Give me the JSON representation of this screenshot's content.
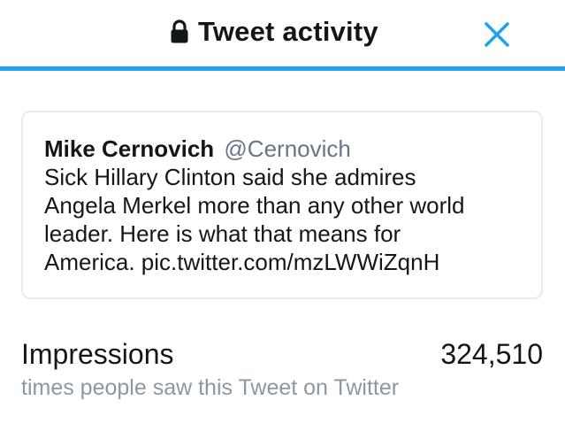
{
  "header": {
    "title": "Tweet activity",
    "icon": "lock-icon",
    "close_icon": "close-icon",
    "accent_color": "#1da1f2"
  },
  "tweet": {
    "author_name": "Mike Cernovich",
    "author_handle": "@Cernovich",
    "text_lines": [
      "Sick Hillary Clinton said she admires",
      "Angela Merkel more than any other world",
      "leader. Here is what that means for",
      "America. pic.twitter.com/mzLWWiZqnH"
    ]
  },
  "metrics": {
    "impressions_label": "Impressions",
    "impressions_value": "324,510",
    "impressions_description": "times people saw this Tweet on Twitter",
    "description_color": "#8899a6"
  }
}
